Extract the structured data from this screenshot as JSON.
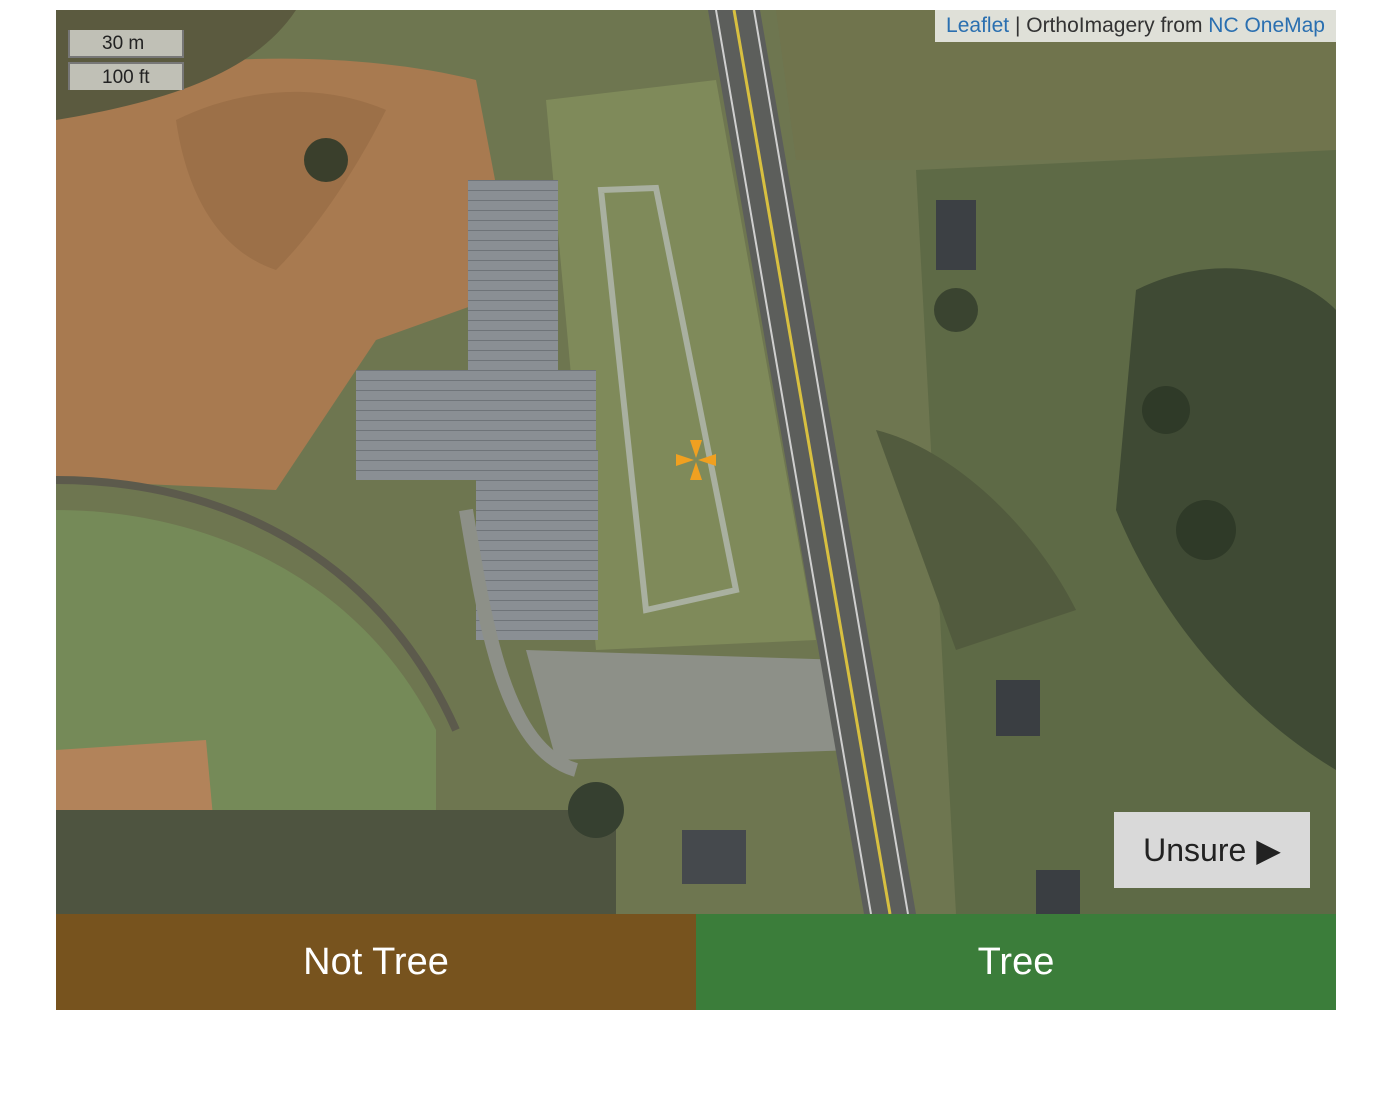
{
  "map": {
    "attribution": {
      "leaflet_link": "Leaflet",
      "separator": " | OrthoImagery from ",
      "source_link": "NC OneMap"
    },
    "scale": {
      "metric": "30 m",
      "imperial": "100 ft"
    },
    "crosshair_color": "#f0a020"
  },
  "controls": {
    "unsure_label": "Unsure",
    "unsure_arrow": "▶"
  },
  "answers": {
    "not_tree_label": "Not Tree",
    "not_tree_color": "#77531e",
    "tree_label": "Tree",
    "tree_color": "#3b7d3a"
  }
}
